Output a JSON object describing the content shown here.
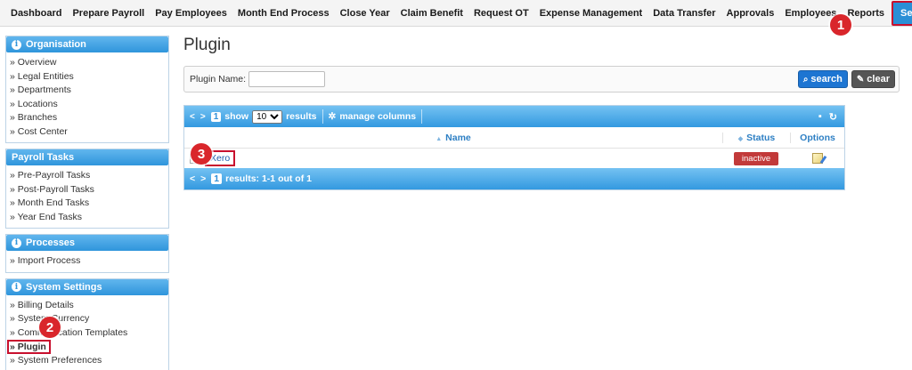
{
  "nav": {
    "items": [
      "Dashboard",
      "Prepare Payroll",
      "Pay Employees",
      "Month End Process",
      "Close Year",
      "Claim Benefit",
      "Request OT",
      "Expense Management",
      "Data Transfer",
      "Approvals",
      "Employees",
      "Reports"
    ],
    "active": "Settings"
  },
  "markers": {
    "one": "1",
    "two": "2",
    "three": "3"
  },
  "sidebar": {
    "organisation": {
      "title": "Organisation",
      "links": [
        "» Overview",
        "» Legal Entities",
        "» Departments",
        "» Locations",
        "» Branches",
        "» Cost Center"
      ]
    },
    "payroll_tasks": {
      "title": "Payroll Tasks",
      "links": [
        "» Pre-Payroll Tasks",
        "» Post-Payroll Tasks",
        "» Month End Tasks",
        "» Year End Tasks"
      ]
    },
    "processes": {
      "title": "Processes",
      "links": [
        "» Import Process"
      ]
    },
    "system_settings": {
      "title": "System Settings",
      "links": [
        "» Billing Details",
        "» System Currency",
        "» Communication Templates",
        "» Plugin",
        "» System Preferences"
      ]
    }
  },
  "main": {
    "title": "Plugin",
    "search": {
      "label": "Plugin Name:",
      "value": "",
      "search_btn": "search",
      "clear_btn": "clear"
    },
    "grid": {
      "page": "1",
      "show_label": "show",
      "per_page": "10",
      "results_label": "results",
      "manage_columns": "manage columns",
      "columns": {
        "name": "Name",
        "status": "Status",
        "options": "Options"
      },
      "rows": [
        {
          "name": "Xero",
          "status": "inactive"
        }
      ],
      "footer_page": "1",
      "footer_results": "results: 1-1 out of 1"
    }
  },
  "colors": {
    "accent": "#2f95dc",
    "marker": "#d9262b",
    "inactive": "#c23a3a"
  },
  "icons": [
    "info-icon",
    "search-icon",
    "clear-icon",
    "gear-icon",
    "save-icon",
    "refresh-icon",
    "edit-icon",
    "sort-icon"
  ]
}
